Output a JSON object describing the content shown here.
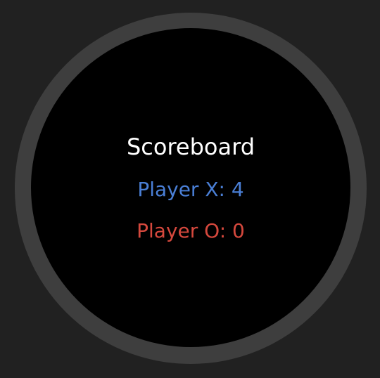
{
  "scoreboard": {
    "title": "Scoreboard",
    "player_x": "Player X: 4",
    "player_o": "Player O: 0"
  },
  "colors": {
    "player_x": "#4a7fd6",
    "player_o": "#d5483d",
    "title": "#ffffff",
    "screen": "#000000",
    "background": "#212121"
  }
}
